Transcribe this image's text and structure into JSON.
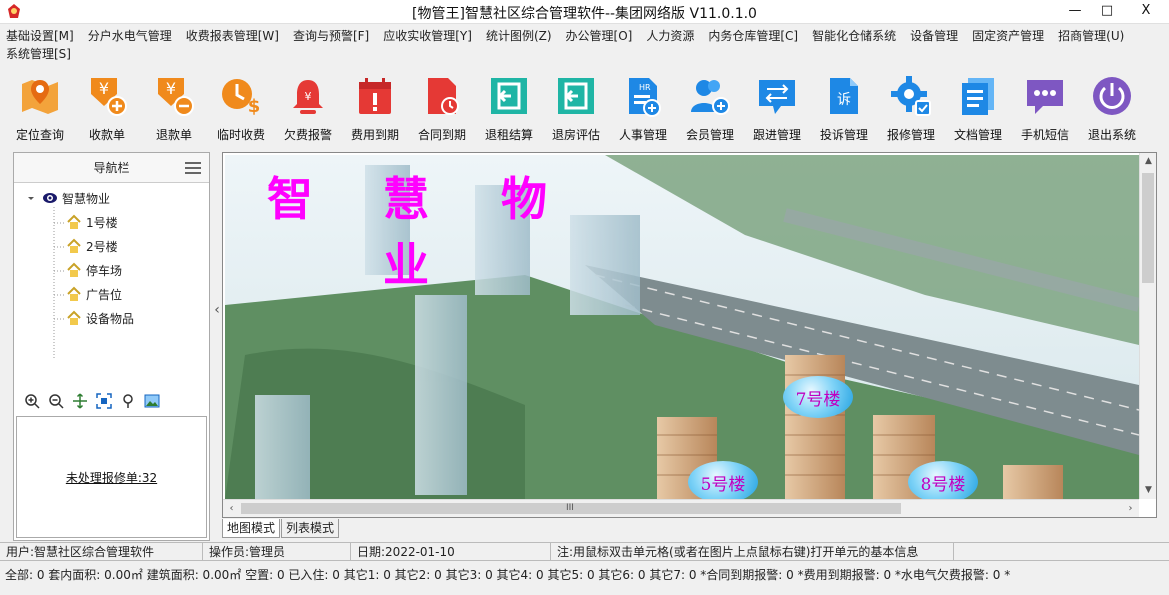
{
  "window": {
    "title": "[物管王]智慧社区综合管理软件--集团网络版 V11.0.1.0",
    "min": "—",
    "max": "□",
    "close": "X"
  },
  "menu": [
    "基础设置[M]",
    "分户水电气管理",
    "收费报表管理[W]",
    "查询与预警[F]",
    "应收实收管理[Y]",
    "统计图例(Z)",
    "办公管理[O]",
    "人力资源",
    "内务仓库管理[C]",
    "智能化仓储系统",
    "设备管理",
    "固定资产管理",
    "招商管理(U)",
    "系统管理[S]"
  ],
  "toolbar": [
    {
      "label": "定位查询",
      "icon": "map-pin-icon",
      "color": "#f08a1c"
    },
    {
      "label": "收款单",
      "icon": "yuan-add-icon",
      "color": "#f08a1c"
    },
    {
      "label": "退款单",
      "icon": "yuan-minus-icon",
      "color": "#f08a1c"
    },
    {
      "label": "临时收费",
      "icon": "clock-dollar-icon",
      "color": "#f08a1c"
    },
    {
      "label": "欠费报警",
      "icon": "bell-icon",
      "color": "#e53935"
    },
    {
      "label": "费用到期",
      "icon": "calendar-alert-icon",
      "color": "#e53935"
    },
    {
      "label": "合同到期",
      "icon": "doc-clock-icon",
      "color": "#e53935"
    },
    {
      "label": "退租结算",
      "icon": "exit-door-icon",
      "color": "#1fb5a5"
    },
    {
      "label": "退房评估",
      "icon": "exit-door-icon",
      "color": "#1fb5a5"
    },
    {
      "label": "人事管理",
      "icon": "hr-doc-icon",
      "color": "#1e88e5"
    },
    {
      "label": "会员管理",
      "icon": "users-add-icon",
      "color": "#1e88e5"
    },
    {
      "label": "跟进管理",
      "icon": "chat-arrows-icon",
      "color": "#1e88e5"
    },
    {
      "label": "投诉管理",
      "icon": "complaint-doc-icon",
      "color": "#1e88e5"
    },
    {
      "label": "报修管理",
      "icon": "gear-icon",
      "color": "#1e88e5"
    },
    {
      "label": "文档管理",
      "icon": "docs-icon",
      "color": "#1e88e5"
    },
    {
      "label": "手机短信",
      "icon": "sms-icon",
      "color": "#7e57c2"
    },
    {
      "label": "退出系统",
      "icon": "power-icon",
      "color": "#7e57c2"
    }
  ],
  "nav": {
    "title": "导航栏",
    "root": "智慧物业",
    "items": [
      "1号楼",
      "2号楼",
      "停车场",
      "广告位",
      "设备物品"
    ],
    "pending": "未处理报修单:32"
  },
  "map": {
    "heading": [
      "智",
      "慧",
      "物",
      "业"
    ],
    "buildings": [
      "7号楼",
      "5号楼",
      "8号楼"
    ],
    "scroll_grip": "III"
  },
  "tabs": [
    "地图模式",
    "列表模式"
  ],
  "status": {
    "user": "用户:智慧社区综合管理软件",
    "operator": "操作员:管理员",
    "date": "日期:2022-01-10",
    "note": "注:用鼠标双击单元格(或者在图片上点鼠标右键)打开单元的基本信息"
  },
  "summary": "全部: 0  套内面积: 0.00㎡  建筑面积: 0.00㎡  空置: 0  已入住: 0  其它1: 0  其它2: 0  其它3: 0  其它4: 0  其它5: 0  其它6: 0  其它7: 0  *合同到期报警: 0  *费用到期报警: 0  *水电气欠费报警: 0  *"
}
